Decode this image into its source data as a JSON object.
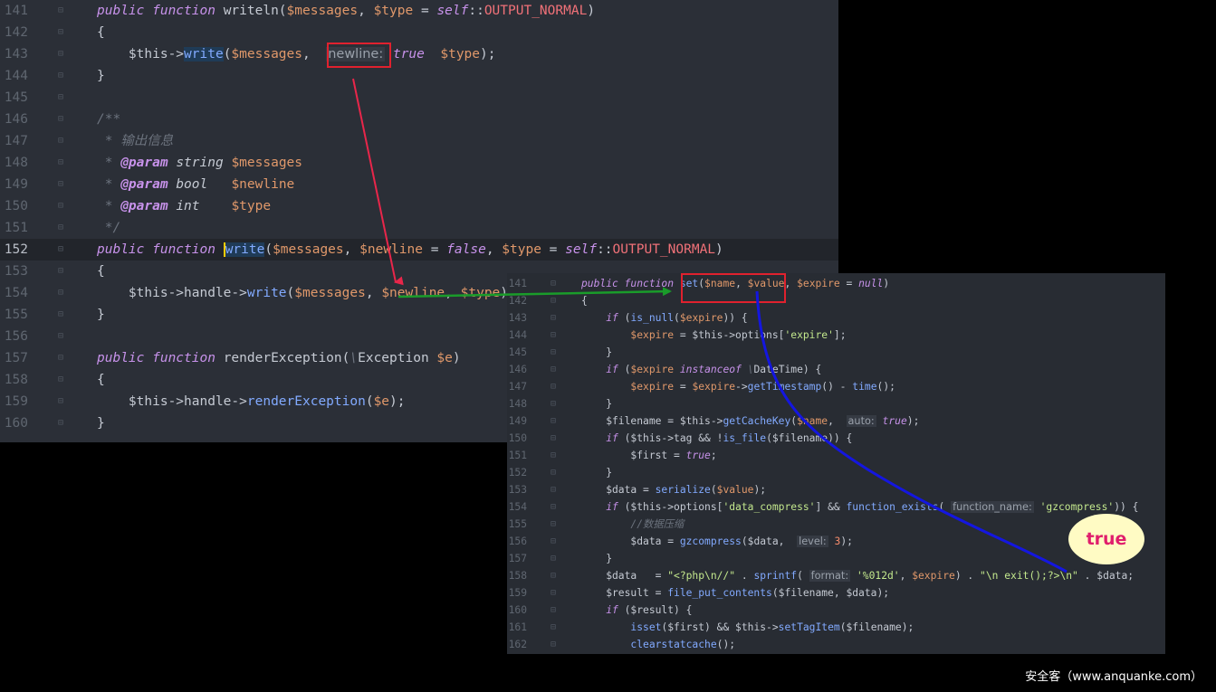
{
  "panel1": {
    "lines": [
      {
        "n": "141",
        "tokens": [
          [
            "t-kw",
            "public function "
          ],
          [
            "t-p",
            "writeln("
          ],
          [
            "t-var",
            "$messages"
          ],
          [
            "t-p",
            ", "
          ],
          [
            "t-var",
            "$type"
          ],
          [
            "t-p",
            " = "
          ],
          [
            "t-kw",
            "self"
          ],
          [
            "t-p",
            "::"
          ],
          [
            "t-con",
            "OUTPUT_NORMAL"
          ],
          [
            "t-p",
            ")"
          ]
        ]
      },
      {
        "n": "142",
        "tokens": [
          [
            "t-p",
            "{"
          ]
        ]
      },
      {
        "n": "143",
        "tokens": [
          [
            "t-p",
            "    $this->"
          ],
          [
            "t-fn hl",
            "write"
          ],
          [
            "t-p",
            "("
          ],
          [
            "t-var",
            "$messages"
          ],
          [
            "t-p",
            ",  "
          ],
          [
            "t-hint",
            "newline:"
          ],
          [
            "t-p",
            " "
          ],
          [
            "t-bool",
            "true"
          ],
          [
            "t-p",
            "  "
          ],
          [
            "t-var",
            "$type"
          ],
          [
            "t-p",
            ");"
          ]
        ]
      },
      {
        "n": "144",
        "tokens": [
          [
            "t-p",
            "}"
          ]
        ]
      },
      {
        "n": "145",
        "tokens": []
      },
      {
        "n": "146",
        "tokens": [
          [
            "t-cm",
            "/**"
          ]
        ]
      },
      {
        "n": "147",
        "tokens": [
          [
            "t-cm",
            " * 输出信息"
          ]
        ]
      },
      {
        "n": "148",
        "tokens": [
          [
            "t-cm",
            " * "
          ],
          [
            "t-tag",
            "@param"
          ],
          [
            "t-typ",
            " string "
          ],
          [
            "t-var",
            "$messages"
          ]
        ]
      },
      {
        "n": "149",
        "tokens": [
          [
            "t-cm",
            " * "
          ],
          [
            "t-tag",
            "@param"
          ],
          [
            "t-typ",
            " bool   "
          ],
          [
            "t-var",
            "$newline"
          ]
        ]
      },
      {
        "n": "150",
        "tokens": [
          [
            "t-cm",
            " * "
          ],
          [
            "t-tag",
            "@param"
          ],
          [
            "t-typ",
            " int    "
          ],
          [
            "t-var",
            "$type"
          ]
        ]
      },
      {
        "n": "151",
        "tokens": [
          [
            "t-cm",
            " */"
          ]
        ]
      },
      {
        "n": "152",
        "tokens": [
          [
            "t-kw",
            "public function "
          ],
          [
            "t-fn hl cursor",
            "write"
          ],
          [
            "t-p",
            "("
          ],
          [
            "t-var",
            "$messages"
          ],
          [
            "t-p",
            ", "
          ],
          [
            "t-var",
            "$newline"
          ],
          [
            "t-p",
            " = "
          ],
          [
            "t-bool",
            "false"
          ],
          [
            "t-p",
            ", "
          ],
          [
            "t-var",
            "$type"
          ],
          [
            "t-p",
            " = "
          ],
          [
            "t-kw",
            "self"
          ],
          [
            "t-p",
            "::"
          ],
          [
            "t-con",
            "OUTPUT_NORMAL"
          ],
          [
            "t-p",
            ")"
          ]
        ]
      },
      {
        "n": "153",
        "tokens": [
          [
            "t-p",
            "{"
          ]
        ]
      },
      {
        "n": "154",
        "tokens": [
          [
            "t-p",
            "    $this->handle->"
          ],
          [
            "t-fn",
            "write"
          ],
          [
            "t-p",
            "("
          ],
          [
            "t-var",
            "$messages"
          ],
          [
            "t-p",
            ", "
          ],
          [
            "t-var",
            "$newline"
          ],
          [
            "t-p",
            ", "
          ],
          [
            "t-var",
            "$type"
          ],
          [
            "t-p",
            ");"
          ]
        ]
      },
      {
        "n": "155",
        "tokens": [
          [
            "t-p",
            "}"
          ]
        ]
      },
      {
        "n": "156",
        "tokens": []
      },
      {
        "n": "157",
        "tokens": [
          [
            "t-kw",
            "public function "
          ],
          [
            "t-p",
            "renderException("
          ],
          [
            "t-cm",
            "\\"
          ],
          [
            "t-p",
            "Exception "
          ],
          [
            "t-var",
            "$e"
          ],
          [
            "t-p",
            ")"
          ]
        ]
      },
      {
        "n": "158",
        "tokens": [
          [
            "t-p",
            "{"
          ]
        ]
      },
      {
        "n": "159",
        "tokens": [
          [
            "t-p",
            "    $this->handle->"
          ],
          [
            "t-fn",
            "renderException"
          ],
          [
            "t-p",
            "("
          ],
          [
            "t-var",
            "$e"
          ],
          [
            "t-p",
            ");"
          ]
        ]
      },
      {
        "n": "160",
        "tokens": [
          [
            "t-p",
            "}"
          ]
        ]
      }
    ]
  },
  "panel2": {
    "lines": [
      {
        "n": "141",
        "tokens": [
          [
            "t-kw",
            "public function "
          ],
          [
            "t-fn",
            "set"
          ],
          [
            "t-p",
            "("
          ],
          [
            "t-var",
            "$name"
          ],
          [
            "t-p",
            ", "
          ],
          [
            "t-var",
            "$value"
          ],
          [
            "t-p",
            ", "
          ],
          [
            "t-var",
            "$expire"
          ],
          [
            "t-p",
            " = "
          ],
          [
            "t-bool",
            "null"
          ],
          [
            "t-p",
            ")"
          ]
        ]
      },
      {
        "n": "142",
        "tokens": [
          [
            "t-p",
            "{"
          ]
        ]
      },
      {
        "n": "143",
        "tokens": [
          [
            "t-p",
            "    "
          ],
          [
            "t-kw",
            "if"
          ],
          [
            "t-p",
            " ("
          ],
          [
            "t-fn",
            "is_null"
          ],
          [
            "t-p",
            "("
          ],
          [
            "t-var",
            "$expire"
          ],
          [
            "t-p",
            ")) {"
          ]
        ]
      },
      {
        "n": "144",
        "tokens": [
          [
            "t-p",
            "        "
          ],
          [
            "t-var",
            "$expire"
          ],
          [
            "t-p",
            " = $this->options["
          ],
          [
            "t-str",
            "'expire'"
          ],
          [
            "t-p",
            "];"
          ]
        ]
      },
      {
        "n": "145",
        "tokens": [
          [
            "t-p",
            "    }"
          ]
        ]
      },
      {
        "n": "146",
        "tokens": [
          [
            "t-p",
            "    "
          ],
          [
            "t-kw",
            "if"
          ],
          [
            "t-p",
            " ("
          ],
          [
            "t-var",
            "$expire"
          ],
          [
            "t-p",
            " "
          ],
          [
            "t-kw",
            "instanceof"
          ],
          [
            "t-p",
            " "
          ],
          [
            "t-cm",
            "\\"
          ],
          [
            "t-p",
            "DateTime) {"
          ]
        ]
      },
      {
        "n": "147",
        "tokens": [
          [
            "t-p",
            "        "
          ],
          [
            "t-var",
            "$expire"
          ],
          [
            "t-p",
            " = "
          ],
          [
            "t-var",
            "$expire"
          ],
          [
            "t-p",
            "->"
          ],
          [
            "t-fn",
            "getTimestamp"
          ],
          [
            "t-p",
            "() - "
          ],
          [
            "t-fn",
            "time"
          ],
          [
            "t-p",
            "();"
          ]
        ]
      },
      {
        "n": "148",
        "tokens": [
          [
            "t-p",
            "    }"
          ]
        ]
      },
      {
        "n": "149",
        "tokens": [
          [
            "t-p",
            "    $filename = $this->"
          ],
          [
            "t-fn",
            "getCacheKey"
          ],
          [
            "t-p",
            "("
          ],
          [
            "t-var",
            "$name"
          ],
          [
            "t-p",
            ",  "
          ],
          [
            "t-hint",
            "auto:"
          ],
          [
            "t-p",
            " "
          ],
          [
            "t-bool",
            "true"
          ],
          [
            "t-p",
            ");"
          ]
        ]
      },
      {
        "n": "150",
        "tokens": [
          [
            "t-p",
            "    "
          ],
          [
            "t-kw",
            "if"
          ],
          [
            "t-p",
            " ($this->tag && !"
          ],
          [
            "t-fn",
            "is_file"
          ],
          [
            "t-p",
            "($filename)) {"
          ]
        ]
      },
      {
        "n": "151",
        "tokens": [
          [
            "t-p",
            "        $first = "
          ],
          [
            "t-bool",
            "true"
          ],
          [
            "t-p",
            ";"
          ]
        ]
      },
      {
        "n": "152",
        "tokens": [
          [
            "t-p",
            "    }"
          ]
        ]
      },
      {
        "n": "153",
        "tokens": [
          [
            "t-p",
            "    $data = "
          ],
          [
            "t-fn",
            "serialize"
          ],
          [
            "t-p",
            "("
          ],
          [
            "t-var",
            "$value"
          ],
          [
            "t-p",
            ");"
          ]
        ]
      },
      {
        "n": "154",
        "tokens": [
          [
            "t-p",
            "    "
          ],
          [
            "t-kw",
            "if"
          ],
          [
            "t-p",
            " ($this->options["
          ],
          [
            "t-str",
            "'data_compress'"
          ],
          [
            "t-p",
            "] && "
          ],
          [
            "t-fn",
            "function_exists"
          ],
          [
            "t-p",
            "( "
          ],
          [
            "t-hint",
            "function_name:"
          ],
          [
            "t-p",
            " "
          ],
          [
            "t-str",
            "'gzcompress'"
          ],
          [
            "t-p",
            ")) {"
          ]
        ]
      },
      {
        "n": "155",
        "tokens": [
          [
            "t-p",
            "        "
          ],
          [
            "t-cm",
            "//数据压缩"
          ]
        ]
      },
      {
        "n": "156",
        "tokens": [
          [
            "t-p",
            "        $data = "
          ],
          [
            "t-fn",
            "gzcompress"
          ],
          [
            "t-p",
            "($data,  "
          ],
          [
            "t-hint",
            "level:"
          ],
          [
            "t-p",
            " "
          ],
          [
            "t-num",
            "3"
          ],
          [
            "t-p",
            ");"
          ]
        ]
      },
      {
        "n": "157",
        "tokens": [
          [
            "t-p",
            "    }"
          ]
        ]
      },
      {
        "n": "158",
        "tokens": [
          [
            "t-p",
            "    $data   = "
          ],
          [
            "t-str",
            "\"<?php\\n//\""
          ],
          [
            "t-p",
            " . "
          ],
          [
            "t-fn",
            "sprintf"
          ],
          [
            "t-p",
            "( "
          ],
          [
            "t-hint",
            "format:"
          ],
          [
            "t-p",
            " "
          ],
          [
            "t-str",
            "'%012d'"
          ],
          [
            "t-p",
            ", "
          ],
          [
            "t-var",
            "$expire"
          ],
          [
            "t-p",
            ") . "
          ],
          [
            "t-str",
            "\"\\n exit();?>\\n\""
          ],
          [
            "t-p",
            " . $data;"
          ]
        ]
      },
      {
        "n": "159",
        "tokens": [
          [
            "t-p",
            "    $result = "
          ],
          [
            "t-fn",
            "file_put_contents"
          ],
          [
            "t-p",
            "($filename, $data);"
          ]
        ]
      },
      {
        "n": "160",
        "tokens": [
          [
            "t-p",
            "    "
          ],
          [
            "t-kw",
            "if"
          ],
          [
            "t-p",
            " ($result) {"
          ]
        ]
      },
      {
        "n": "161",
        "tokens": [
          [
            "t-p",
            "        "
          ],
          [
            "t-fn",
            "isset"
          ],
          [
            "t-p",
            "($first) && $this->"
          ],
          [
            "t-fn",
            "setTagItem"
          ],
          [
            "t-p",
            "($filename);"
          ]
        ]
      },
      {
        "n": "162",
        "tokens": [
          [
            "t-p",
            "        "
          ],
          [
            "t-fn",
            "clearstatcache"
          ],
          [
            "t-p",
            "();"
          ]
        ]
      }
    ]
  },
  "annotation": {
    "label": "true"
  },
  "watermark": "安全客（www.anquanke.com）",
  "colors": {
    "red_arrow": "#e8264a",
    "green_arrow": "#1a9c2a",
    "blue_curve": "#1416e0",
    "box": "#e0212e"
  }
}
